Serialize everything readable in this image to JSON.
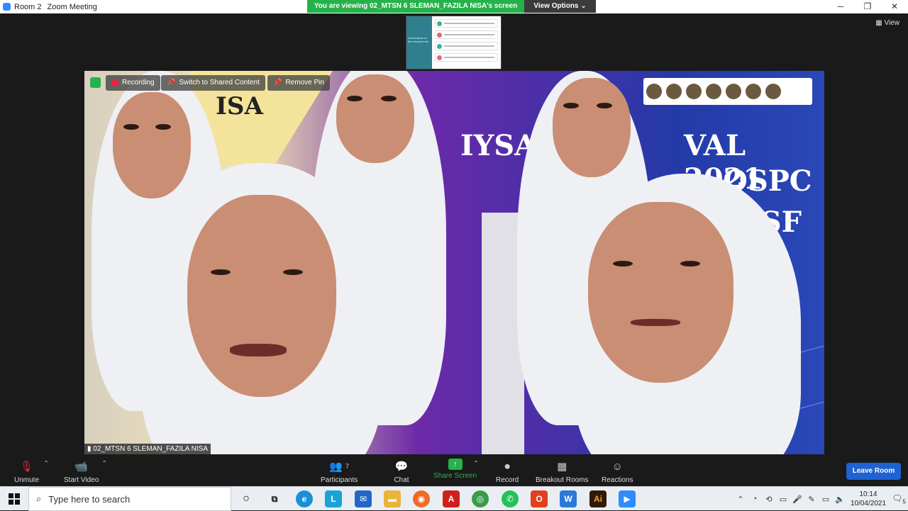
{
  "window": {
    "room": "Room 2",
    "title": "Zoom Meeting",
    "minimize": "─",
    "restore": "❐",
    "close": "✕"
  },
  "share": {
    "banner": "You are viewing 02_MTSN 6 SLEMAN_FAZILA NISA's screen",
    "view_options": "View Options ⌄"
  },
  "thumbnail": {
    "left_text": "Conclusions of the research are"
  },
  "view_button": "▦ View",
  "video": {
    "recording": "Recording",
    "switch_content": "Switch to Shared Content",
    "remove_pin": "Remove Pin",
    "banner_lines": [
      "IYSA",
      "VAL 2021",
      "OSPC",
      "ISF",
      "SF"
    ],
    "participant_name": "02_MTSN 6 SLEMAN_FAZILA NISA",
    "logo_letters": "ISA"
  },
  "toolbar": {
    "unmute": "Unmute",
    "start_video": "Start Video",
    "participants": "Participants",
    "participants_count": "7",
    "chat": "Chat",
    "share_screen": "Share Screen",
    "record": "Record",
    "breakout_rooms": "Breakout Rooms",
    "reactions": "Reactions",
    "leave": "Leave Room"
  },
  "taskbar": {
    "search_placeholder": "Type here to search",
    "time": "10:14",
    "date": "10/04/2021",
    "notifications": "5"
  },
  "colors": {
    "zoom_blue": "#2d8cff",
    "share_green": "#26b24b",
    "leave_blue": "#1f62d1"
  }
}
